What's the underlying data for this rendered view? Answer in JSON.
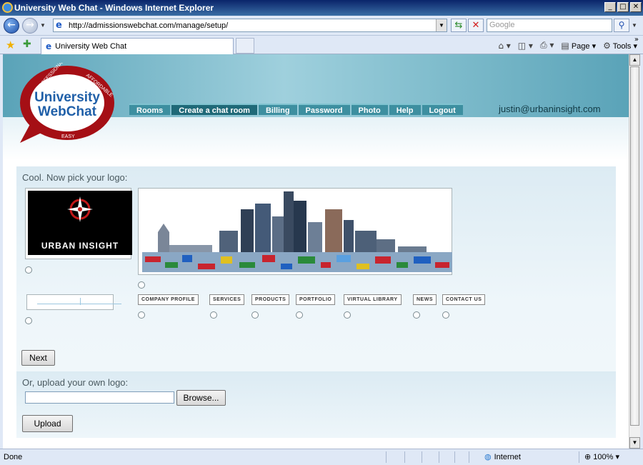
{
  "window": {
    "title": "University Web Chat - Windows Internet Explorer",
    "controls": [
      "_",
      "□",
      "✕"
    ]
  },
  "address_bar": {
    "url": "http://admissionswebchat.com/manage/setup/",
    "search_placeholder": "Google"
  },
  "tabs": [
    {
      "label": "University Web Chat"
    }
  ],
  "command_bar": {
    "page_label": "Page",
    "tools_label": "Tools"
  },
  "site": {
    "logo": {
      "line1": "University",
      "line2": "WebChat",
      "ring_top_left": "PROFESSIONAL",
      "ring_top_right": "AFFORDABLE",
      "ring_bottom": "EASY"
    },
    "nav": [
      {
        "label": "Rooms",
        "active": false
      },
      {
        "label": "Create a chat room",
        "active": true
      },
      {
        "label": "Billing",
        "active": false
      },
      {
        "label": "Password",
        "active": false
      },
      {
        "label": "Photo",
        "active": false
      },
      {
        "label": "Help",
        "active": false
      },
      {
        "label": "Logout",
        "active": false
      }
    ],
    "user_email": "justin@urbaninsight.com"
  },
  "main": {
    "pick_heading": "Cool. Now pick your logo:",
    "urban_insight_text": "URBAN INSIGHT",
    "mini_buttons": [
      "COMPANY PROFILE",
      "SERVICES",
      "PRODUCTS",
      "PORTFOLIO",
      "VIRTUAL LIBRARY",
      "NEWS",
      "CONTACT US"
    ],
    "next_label": "Next",
    "upload_heading": "Or, upload your own logo:",
    "file_value": "",
    "browse_label": "Browse...",
    "upload_label": "Upload"
  },
  "status_bar": {
    "status": "Done",
    "zone": "Internet",
    "zoom": "100%"
  },
  "colors": {
    "header_teal": "#5aa3b8",
    "nav_bg": "#3d8fa0",
    "nav_active": "#1f6978",
    "logo_red": "#a50f15",
    "logo_blue": "#1f5fa8"
  }
}
